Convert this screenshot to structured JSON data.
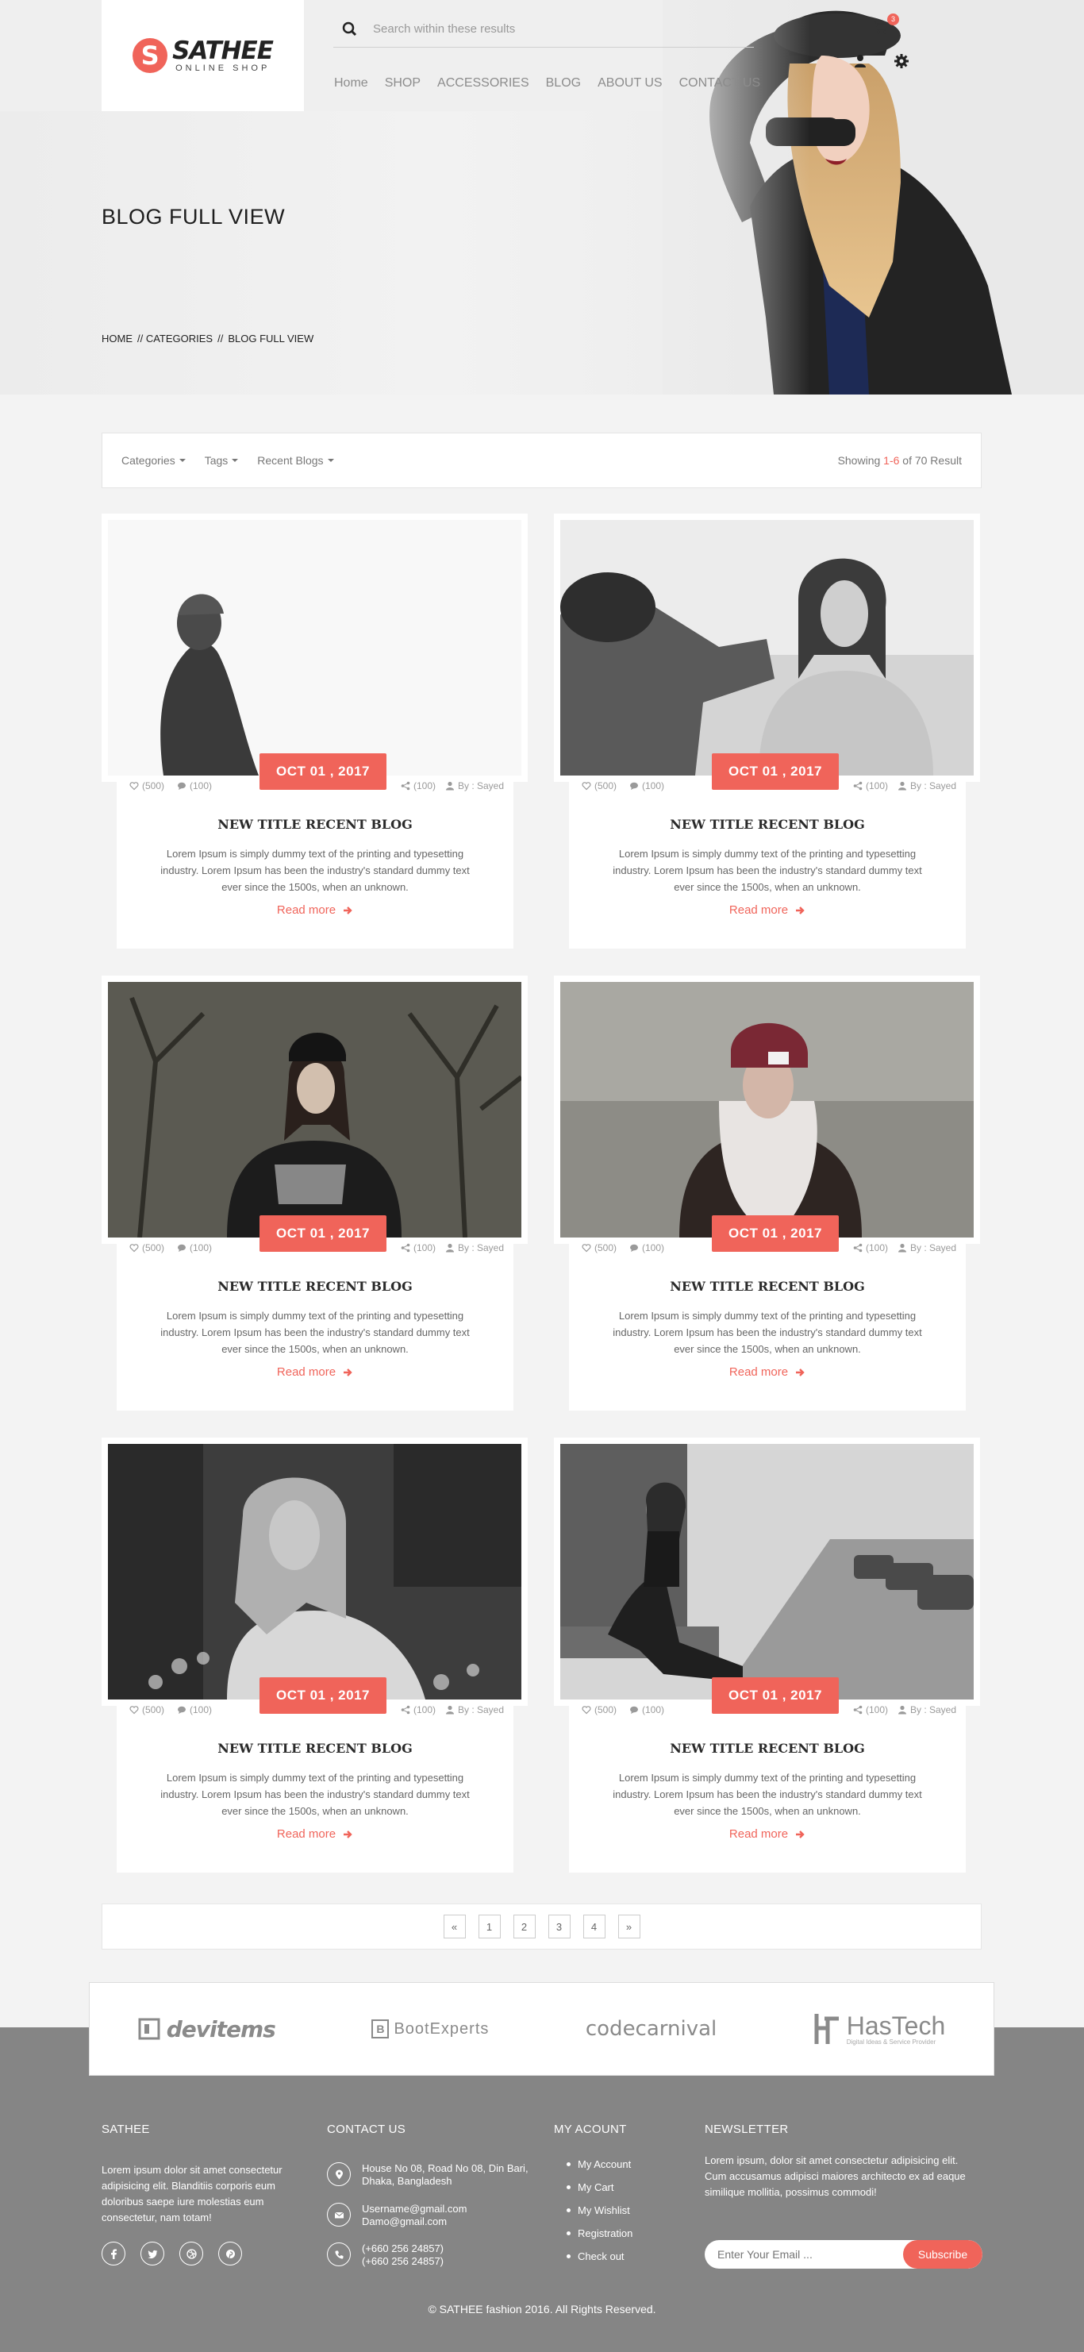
{
  "header": {
    "logo_mark": "S",
    "logo_name": "SATHEE",
    "logo_sub": "ONLINE SHOP",
    "search_placeholder": "Search within these results",
    "cart_count": "3",
    "nav": [
      "Home",
      "SHOP",
      "ACCESSORIES",
      "BLOG",
      "ABOUT US",
      "CONTACT US"
    ]
  },
  "hero": {
    "title": "BLOG FULL VIEW",
    "breadcrumb": [
      "HOME",
      "// CATEGORIES",
      "//",
      "BLOG FULL VIEW"
    ]
  },
  "filter": {
    "categories": "Categories",
    "tags": "Tags",
    "recent": "Recent Blogs",
    "showing_prefix": "Showing ",
    "showing_range": "1-6",
    "showing_suffix": " of 70 Result"
  },
  "posts": [
    {
      "date": "OCT 01 , 2017",
      "likes": "(500)",
      "comments": "(100)",
      "shares": "(100)",
      "author": "By : Sayed",
      "title": "NEW TITLE RECENT BLOG",
      "excerpt": "Lorem Ipsum is simply dummy text of the printing and typesetting industry. Lorem Ipsum has been the industry's standard dummy text ever since the 1500s, when an unknown.",
      "read_more": "Read more"
    },
    {
      "date": "OCT 01 , 2017",
      "likes": "(500)",
      "comments": "(100)",
      "shares": "(100)",
      "author": "By : Sayed",
      "title": "NEW TITLE RECENT BLOG",
      "excerpt": "Lorem Ipsum is simply dummy text of the printing and typesetting industry. Lorem Ipsum has been the industry's standard dummy text ever since the 1500s, when an unknown.",
      "read_more": "Read more"
    },
    {
      "date": "OCT 01 , 2017",
      "likes": "(500)",
      "comments": "(100)",
      "shares": "(100)",
      "author": "By : Sayed",
      "title": "NEW TITLE RECENT BLOG",
      "excerpt": "Lorem Ipsum is simply dummy text of the printing and typesetting industry. Lorem Ipsum has been the industry's standard dummy text ever since the 1500s, when an unknown.",
      "read_more": "Read more"
    },
    {
      "date": "OCT 01 , 2017",
      "likes": "(500)",
      "comments": "(100)",
      "shares": "(100)",
      "author": "By : Sayed",
      "title": "NEW TITLE RECENT BLOG",
      "excerpt": "Lorem Ipsum is simply dummy text of the printing and typesetting industry. Lorem Ipsum has been the industry's standard dummy text ever since the 1500s, when an unknown.",
      "read_more": "Read more"
    },
    {
      "date": "OCT 01 , 2017",
      "likes": "(500)",
      "comments": "(100)",
      "shares": "(100)",
      "author": "By : Sayed",
      "title": "NEW TITLE RECENT BLOG",
      "excerpt": "Lorem Ipsum is simply dummy text of the printing and typesetting industry. Lorem Ipsum has been the industry's standard dummy text ever since the 1500s, when an unknown.",
      "read_more": "Read more"
    },
    {
      "date": "OCT 01 , 2017",
      "likes": "(500)",
      "comments": "(100)",
      "shares": "(100)",
      "author": "By : Sayed",
      "title": "NEW TITLE RECENT BLOG",
      "excerpt": "Lorem Ipsum is simply dummy text of the printing and typesetting industry. Lorem Ipsum has been the industry's standard dummy text ever since the 1500s, when an unknown.",
      "read_more": "Read more"
    }
  ],
  "pagination": [
    "«",
    "1",
    "2",
    "3",
    "4",
    "»"
  ],
  "brands": {
    "devitems": "devitems",
    "bootexperts": "BootExperts",
    "codecarnival": "codecarnival",
    "hastech": "HasTech",
    "hastech_tag": "Digital Ideas & Service Provider"
  },
  "footer": {
    "about_title": "SATHEE",
    "about_text": "Lorem ipsum dolor sit amet consectetur adipisicing elit. Blanditiis corporis eum doloribus saepe iure molestias eum consectetur, nam totam!",
    "contact_title": "CONTACT US",
    "address": "House No 08, Road No 08, Din Bari, Dhaka, Bangladesh",
    "email_1": "Username@gmail.com",
    "email_2": "Damo@gmail.com",
    "phone_1": "(+660 256 24857)",
    "phone_2": "(+660 256 24857)",
    "account_title": "MY ACOUNT",
    "account_links": [
      "My Account",
      "My Cart",
      "My Wishlist",
      "Registration",
      "Check out"
    ],
    "newsletter_title": "NEWSLETTER",
    "newsletter_text": "Lorem ipsum, dolor sit amet consectetur adipisicing elit. Cum accusamus adipisci maiores architecto ex ad eaque similique mollitia, possimus commodi!",
    "newsletter_placeholder": "Enter Your Email ...",
    "subscribe": "Subscribe",
    "copyright": "© SATHEE fashion 2016. All Rights Reserved."
  },
  "colors": {
    "accent": "#f0645a",
    "footer_bg": "#858585"
  }
}
